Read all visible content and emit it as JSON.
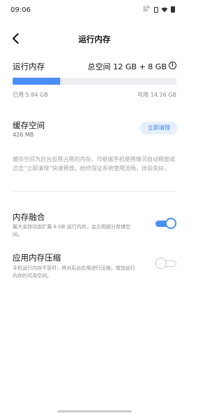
{
  "status_bar": {
    "time": "09:06",
    "net_speed_value": "0.20",
    "net_speed_unit": "K/s"
  },
  "header": {
    "title": "运行内存"
  },
  "memory": {
    "label": "运行内存",
    "total": "总空间 12 GB + 8 GB",
    "info_icon": "i",
    "used": "已用 5.84 GB",
    "available": "可用 14.16 GB",
    "used_fraction": 0.292,
    "accent_color": "#4c8ef7"
  },
  "cache": {
    "title": "缓存空间",
    "size": "426 MB",
    "clean_button": "立即清理",
    "description": "缓存空间为后台应用占用的内存，可根据手机使用情况自动释放或点击“立即清理”快速释放，始终保证系统使用流畅，体验良好。"
  },
  "settings": [
    {
      "title": "内存融合",
      "description": "最大支持动态扩展 8 GB 运行内存，会占用部分存储空间。",
      "enabled": true
    },
    {
      "title": "应用内存压缩",
      "description": "手机运行内存不足时，将对后台应用进行压缩，增加运行内存的可用空间。",
      "enabled": false
    }
  ],
  "icons": {
    "back": "chevron-left-icon",
    "info": "info-icon",
    "wifi": "wifi-icon",
    "battery": "battery-icon",
    "sim": "sim-card-icon"
  }
}
